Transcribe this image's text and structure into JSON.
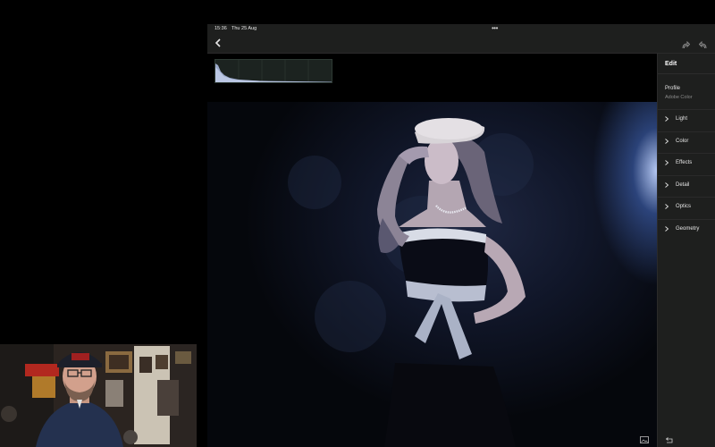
{
  "status_bar": {
    "time": "15:36",
    "date": "Thu 25 Aug",
    "multitask": "•••"
  },
  "top_bar": {
    "back_icon": "chevron-left-icon",
    "redo_icon": "redo-icon",
    "undo_icon": "undo-icon"
  },
  "panel": {
    "title": "Edit",
    "profile_label": "Profile",
    "profile_value": "Adobe Color",
    "sections": [
      {
        "label": "Light"
      },
      {
        "label": "Color"
      },
      {
        "label": "Effects"
      },
      {
        "label": "Detail"
      },
      {
        "label": "Optics"
      },
      {
        "label": "Geometry"
      }
    ]
  },
  "colors": {
    "panel_bg": "#1e1f1e",
    "accent_light": "#6f8fd8",
    "backdrop": "#0b0f1a"
  }
}
